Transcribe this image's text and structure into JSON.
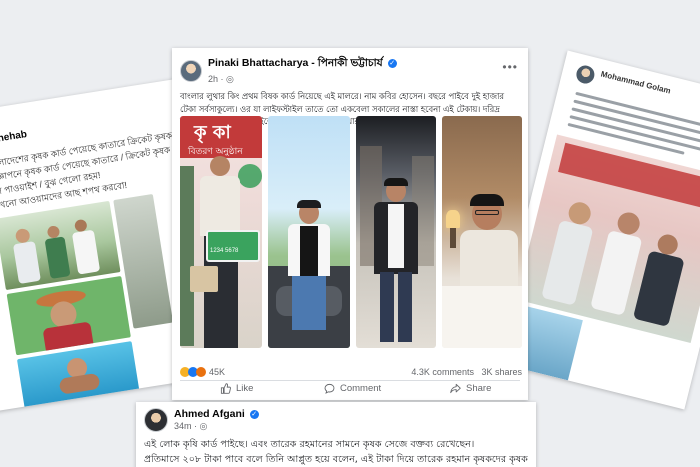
{
  "left_post": {
    "author": "h Shehab",
    "lines": [
      "বাংলাদেশের কৃষক কার্ড পেয়েছে কাতারে ক্রিকেট কৃষক লীগ / হবি দি এ",
      "বিজ্ঞাপনে কৃষক কার্ড পেয়েছে কাতারে / ক্রিকেট কৃষক লীগ",
      "হল পাওয়াইশ / বুঝ গেলো রহম!",
      "এখনো আওয়ামদের আছ শপথ করবো!"
    ]
  },
  "right_post": {
    "author": "Mohammad Golam"
  },
  "main_post": {
    "author_en": "Pinaki Bhattacharya",
    "separator": " - ",
    "author_bn": "পিনাকী ভট্টাচার্য",
    "time": "2h",
    "text": "বাংলার লুথার কিং প্রথম বিষক কার্ড নিয়েছে এই মালরে। নাম কবির হোসেন। বছরে পাইবে দুই হাজার টেকা সর্বসাকুল্যে। ওর যা লাইফস্টাইল তাতে তো একবেলা সকালের নাস্তা হবেনা এই টেকায়। দরিদ্র কৃষকেরা ফসলের দাম পাইতেছে না। আর বাংলার লুথার কিং নাটক করতেছে।",
    "photo_banner_1": "কৃ কা",
    "photo_banner_2": "বিতরণ অনুষ্ঠান",
    "photo_card_text": "1234 5678",
    "reaction_count": "45K",
    "comments": "4.3K comments",
    "shares": "3K shares",
    "actions": {
      "like": "Like",
      "comment": "Comment",
      "share": "Share"
    }
  },
  "bottom_post": {
    "author": "Ahmed Afgani",
    "time": "34m",
    "line1": "এই লোক কৃষি কার্ড পাইছে। এবং তারেক রহমানের সামনে কৃষক সেজে বক্তব্য রেখেছেন।",
    "line2": "প্রতিমাসে ২০৮ টাকা পাবে বলে তিনি আপ্লুত হয়ে বলেন, এই টাকা দিয়ে তারেক রহমান কৃষকদের কৃষক"
  },
  "colors": {
    "facebook_blue": "#1877f2",
    "meta_gray": "#65676b",
    "banner_red": "#c23a3a",
    "banner_green": "#2e9b52"
  }
}
